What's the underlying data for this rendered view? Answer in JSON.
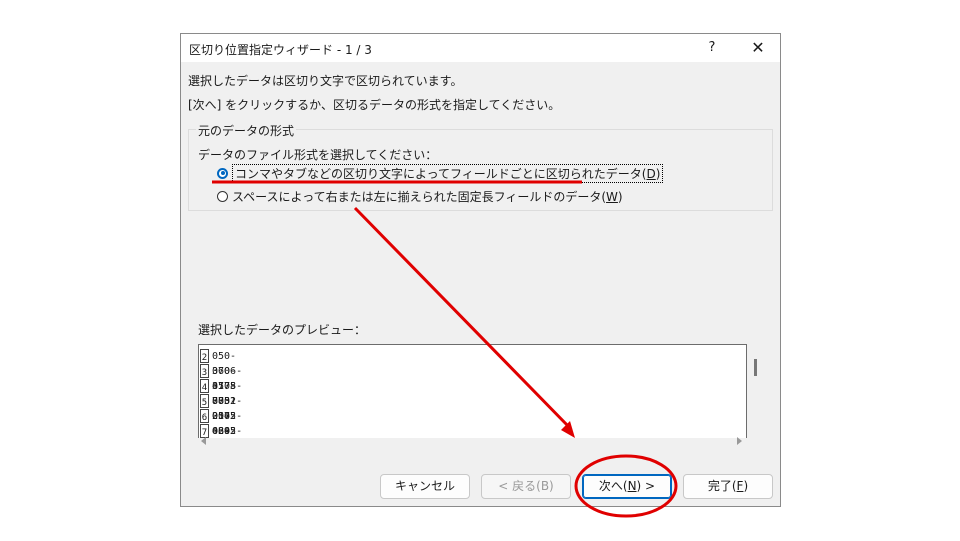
{
  "dialog": {
    "title": "区切り位置指定ウィザード - 1 / 3",
    "help_label": "?",
    "close_label": "✕",
    "line1": "選択したデータは区切り文字で区切られています。",
    "line2": "[次へ] をクリックするか、区切るデータの形式を指定してください。",
    "group_title": "元のデータの形式",
    "prompt": "データのファイル形式を選択してください：",
    "option1": {
      "text": "コンマやタブなどの区切り文字によってフィールドごとに区切られたデータ(",
      "key": "D",
      "end": ")",
      "selected": true
    },
    "option2": {
      "text": "スペースによって右または左に揃えられた固定長フィールドのデータ(",
      "key": "W",
      "end": ")",
      "selected": false
    },
    "preview_label": "選択したデータのプレビュー：",
    "preview_rows": [
      {
        "num": "2",
        "value": "050-3606-3175"
      },
      {
        "num": "3",
        "value": "070-4778-7032"
      },
      {
        "num": "4",
        "value": "050-8751-2045"
      },
      {
        "num": "5",
        "value": "080-0172-4292"
      },
      {
        "num": "6",
        "value": "050-0645-2485"
      },
      {
        "num": "7",
        "value": "080-6783-4203"
      }
    ],
    "buttons": {
      "cancel": "キャンセル",
      "back": "< 戻る(B)",
      "next_pre": "次へ(",
      "next_key": "N",
      "next_post": ") >",
      "finish_pre": "完了(",
      "finish_key": "F",
      "finish_post": ")"
    }
  },
  "colors": {
    "accent": "#0067c0",
    "annotation": "#e00000"
  }
}
